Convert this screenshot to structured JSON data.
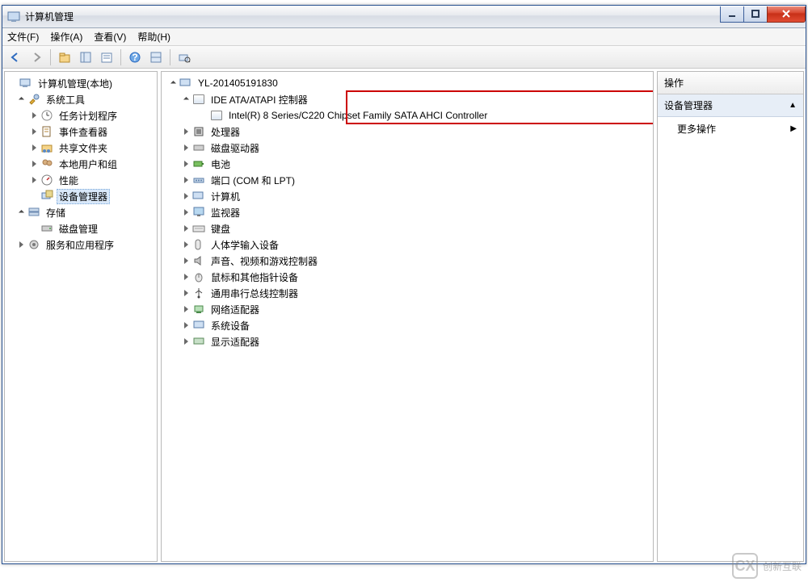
{
  "title": "计算机管理",
  "menu": {
    "file": "文件(F)",
    "action": "操作(A)",
    "view": "查看(V)",
    "help": "帮助(H)"
  },
  "left_tree": {
    "root": "计算机管理(本地)",
    "system_tools": "系统工具",
    "task_scheduler": "任务计划程序",
    "event_viewer": "事件查看器",
    "shared_folders": "共享文件夹",
    "local_users": "本地用户和组",
    "performance": "性能",
    "device_manager": "设备管理器",
    "storage": "存储",
    "disk_mgmt": "磁盘管理",
    "services": "服务和应用程序"
  },
  "mid_tree": {
    "root": "YL-201405191830",
    "ide": "IDE ATA/ATAPI 控制器",
    "ide_child": "Intel(R) 8 Series/C220 Chipset Family SATA AHCI Controller",
    "processor": "处理器",
    "disk_drives": "磁盘驱动器",
    "battery": "电池",
    "ports": "端口 (COM 和 LPT)",
    "computer": "计算机",
    "monitor": "监视器",
    "keyboard": "键盘",
    "hid": "人体学输入设备",
    "sound": "声音、视频和游戏控制器",
    "mouse": "鼠标和其他指针设备",
    "usb": "通用串行总线控制器",
    "network": "网络适配器",
    "system_dev": "系统设备",
    "display": "显示适配器"
  },
  "right": {
    "header": "操作",
    "sub": "设备管理器",
    "more": "更多操作"
  },
  "watermark": "创新互联"
}
